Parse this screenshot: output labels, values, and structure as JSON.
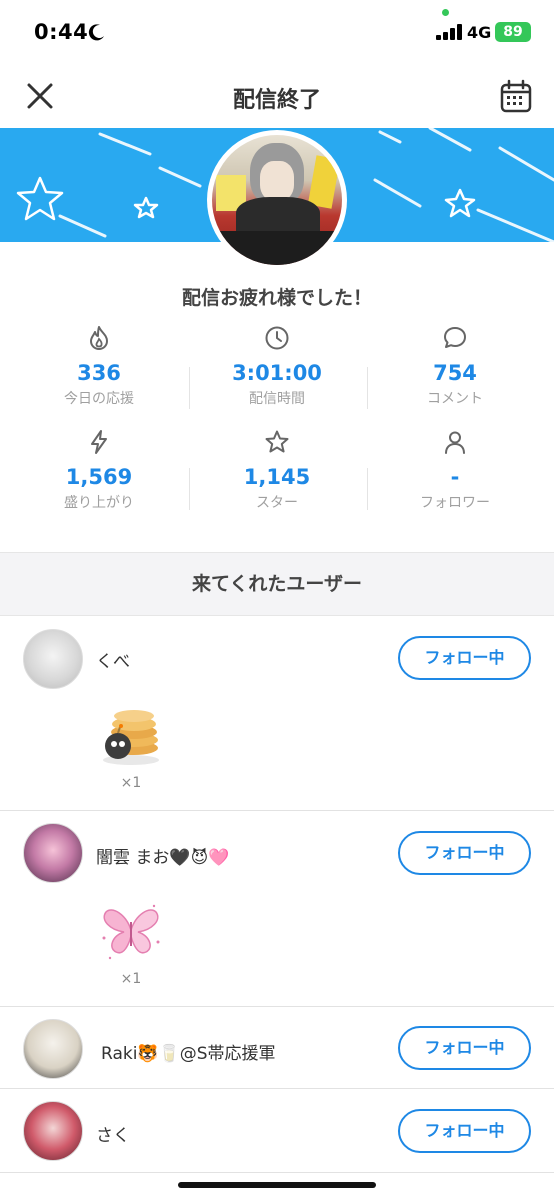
{
  "status_bar": {
    "time": "0:44",
    "network": "4G",
    "battery": "89"
  },
  "header": {
    "title": "配信終了"
  },
  "greeting": "配信お疲れ様でした！",
  "stats": [
    {
      "icon": "flame-icon",
      "value": "336",
      "label": "今日の応援"
    },
    {
      "icon": "clock-icon",
      "value": "3:01:00",
      "label": "配信時間"
    },
    {
      "icon": "comment-icon",
      "value": "754",
      "label": "コメント"
    },
    {
      "icon": "lightning-icon",
      "value": "1,569",
      "label": "盛り上がり"
    },
    {
      "icon": "star-icon",
      "value": "1,145",
      "label": "スター"
    },
    {
      "icon": "person-icon",
      "value": "-",
      "label": "フォロワー"
    }
  ],
  "section_title": "来てくれたユーザー",
  "viewers": [
    {
      "name": "くべ",
      "follow_label": "フォロー中",
      "gift": {
        "icon": "pancake-bomb-gift-icon",
        "count": "×1"
      }
    },
    {
      "name": "闇雲 まお🖤😈🩷",
      "follow_label": "フォロー中",
      "gift": {
        "icon": "pink-butterfly-gift-icon",
        "count": "×1"
      }
    },
    {
      "name": "Raki🐯🥛@S帯応援軍",
      "follow_label": "フォロー中"
    },
    {
      "name": "さく",
      "follow_label": "フォロー中"
    }
  ],
  "colors": {
    "accent": "#1e88e5",
    "banner": "#29a9f0",
    "battery": "#34c759"
  }
}
